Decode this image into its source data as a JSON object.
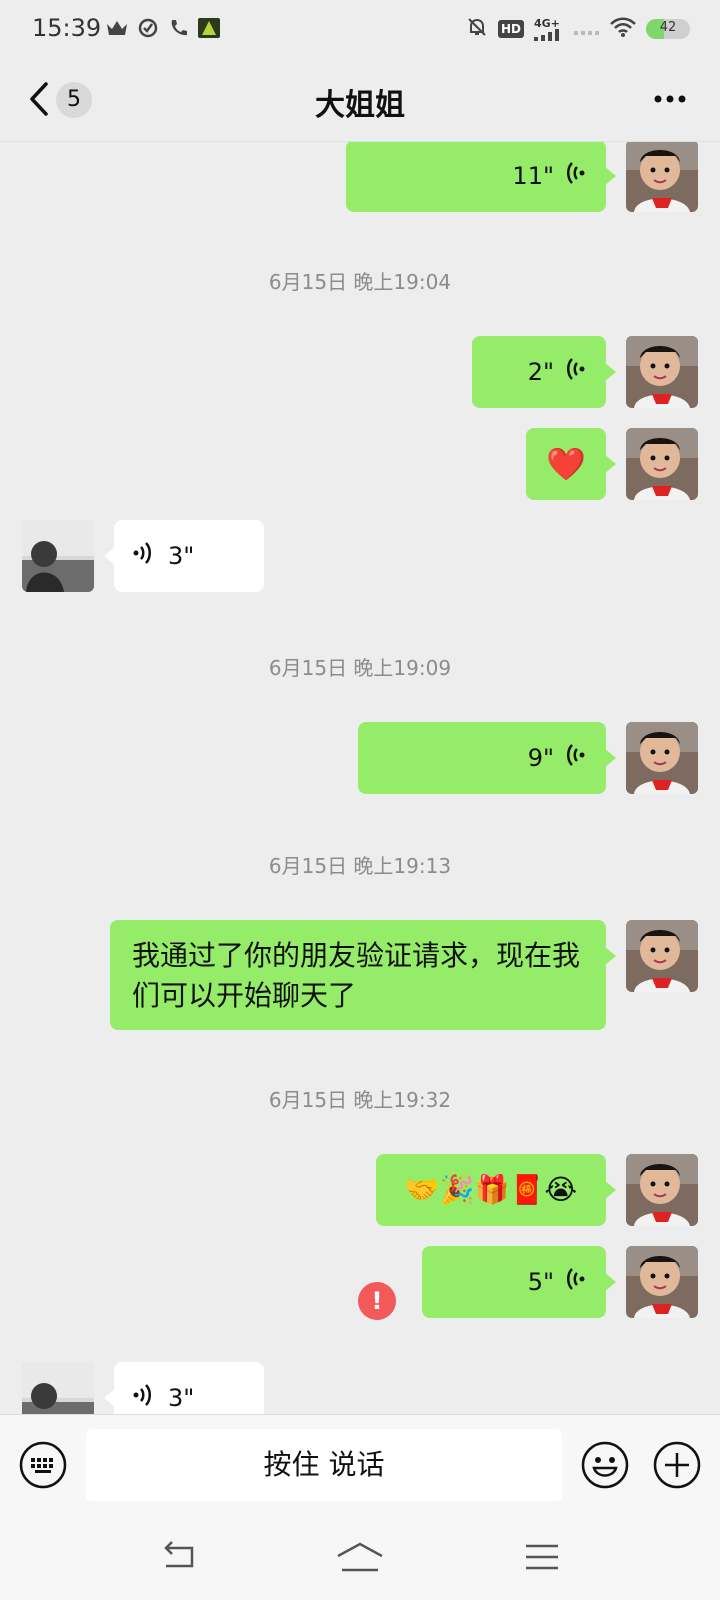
{
  "status_bar": {
    "time": "15:39",
    "network_label": "4G+",
    "hd_label": "HD",
    "battery_level": "42",
    "battery_fraction": 0.42,
    "icons": [
      "crown-icon",
      "check-circle-icon",
      "phone-icon",
      "app-icon",
      "bell-off-icon",
      "hd-icon",
      "signal-icon",
      "wifi-icon",
      "battery-icon"
    ]
  },
  "header": {
    "unread_count": "5",
    "title": "大姐姐"
  },
  "chat": {
    "timestamps": [
      "6月15日 晚上19:04",
      "6月15日 晚上19:09",
      "6月15日 晚上19:13",
      "6月15日 晚上19:32"
    ],
    "messages": [
      {
        "sender": "me",
        "type": "voice",
        "duration": "11\""
      },
      {
        "sender": "me",
        "type": "voice",
        "duration": "2\""
      },
      {
        "sender": "me",
        "type": "emoji",
        "content": "❤️"
      },
      {
        "sender": "them",
        "type": "voice",
        "duration": "3\""
      },
      {
        "sender": "me",
        "type": "voice",
        "duration": "9\""
      },
      {
        "sender": "me",
        "type": "text",
        "content": "我通过了你的朋友验证请求，现在我们可以开始聊天了"
      },
      {
        "sender": "me",
        "type": "emoji",
        "content": "🤝🎉🎁🧧😭"
      },
      {
        "sender": "me",
        "type": "voice",
        "duration": "5\"",
        "failed": true
      },
      {
        "sender": "them",
        "type": "voice",
        "duration": "3\""
      }
    ]
  },
  "input_bar": {
    "talk_label": "按住 说话"
  },
  "colors": {
    "my_bubble": "#95ec69",
    "their_bubble": "#ffffff",
    "background": "#ededed",
    "error": "#f25959"
  }
}
